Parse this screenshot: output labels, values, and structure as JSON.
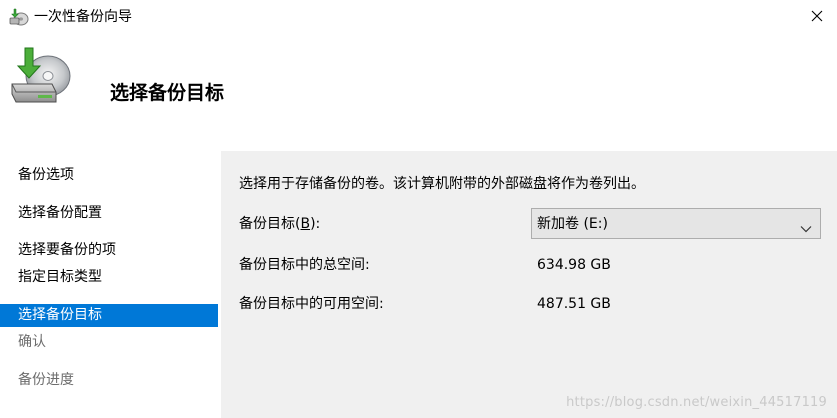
{
  "window": {
    "title": "一次性备份向导",
    "icon": "backup-wizard-icon",
    "close_icon": "close-icon"
  },
  "header": {
    "title": "选择备份目标",
    "icon": "backup-disk-icon"
  },
  "nav": {
    "items": [
      {
        "label": "备份选项",
        "state": "normal"
      },
      {
        "label": "选择备份配置",
        "state": "normal"
      },
      {
        "label": "选择要备份的项",
        "state": "normal"
      },
      {
        "label": "指定目标类型",
        "state": "normal"
      },
      {
        "label": "选择备份目标",
        "state": "selected"
      },
      {
        "label": "确认",
        "state": "disabled"
      },
      {
        "label": "备份进度",
        "state": "disabled"
      }
    ]
  },
  "content": {
    "intro": "选择用于存储备份的卷。该计算机附带的外部磁盘将作为卷列出。",
    "target_label_prefix": "备份目标(",
    "target_label_accel": "B",
    "target_label_suffix": "):",
    "target_value": "新加卷 (E:)",
    "total_label": "备份目标中的总空间:",
    "total_value": "634.98 GB",
    "free_label": "备份目标中的可用空间:",
    "free_value": "487.51 GB"
  },
  "watermark": "https://blog.csdn.net/weixin_44517119",
  "colors": {
    "selected_bg": "#0078d7",
    "content_bg": "#f0f0f0",
    "disabled_text": "#6d6d6d"
  }
}
